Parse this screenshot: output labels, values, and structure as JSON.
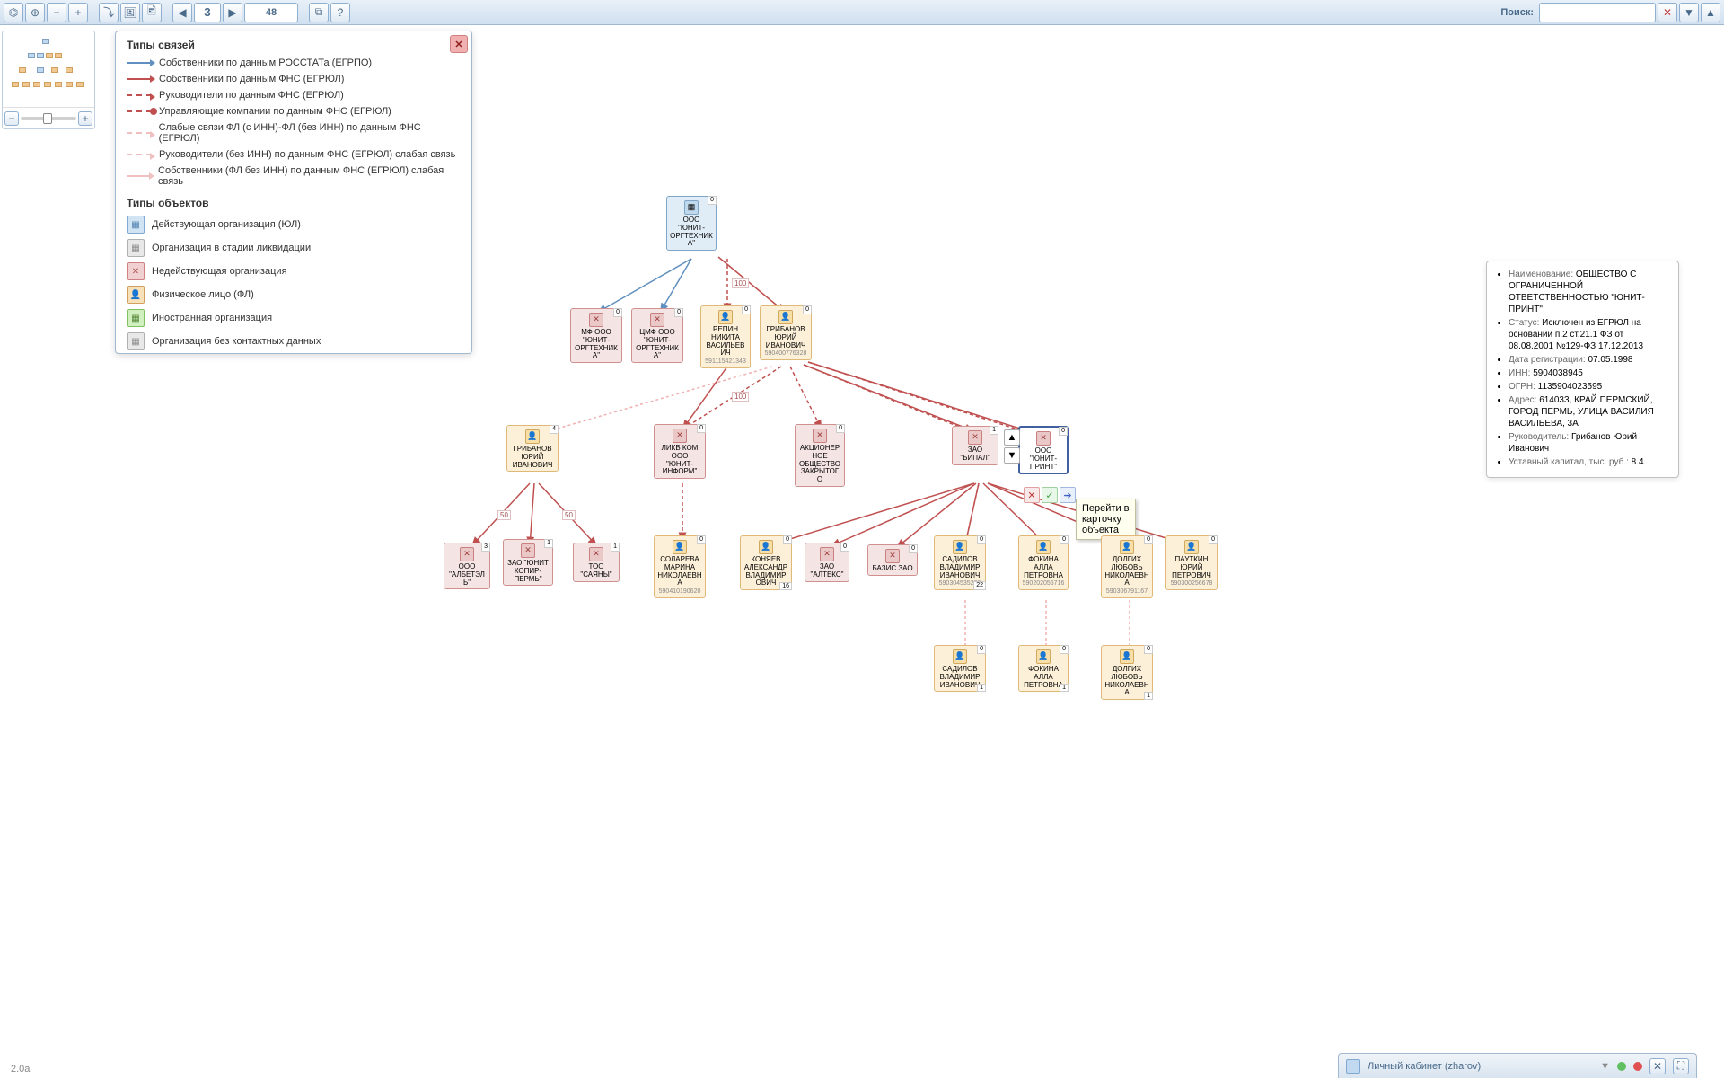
{
  "toolbar": {
    "page_value": "3",
    "counter": "48",
    "search_label": "Поиск:"
  },
  "legend": {
    "title_links": "Типы связей",
    "l1": "Собственники по данным РОССТАТа (ЕГРПО)",
    "l2": "Собственники по данным ФНС (ЕГРЮЛ)",
    "l3": "Руководители по данным ФНС (ЕГРЮЛ)",
    "l4": "Управляющие компании по данным ФНС (ЕГРЮЛ)",
    "l5": "Слабые связи ФЛ (с ИНН)-ФЛ (без ИНН) по данным ФНС (ЕГРЮЛ)",
    "l6": "Руководители (без ИНН) по данным ФНС (ЕГРЮЛ) слабая связь",
    "l7": "Собственники (ФЛ без ИНН) по данным ФНС (ЕГРЮЛ) слабая связь",
    "title_obj": "Типы объектов",
    "o1": "Действующая организация (ЮЛ)",
    "o2": "Организация в стадии ликвидации",
    "o3": "Недействующая организация",
    "o4": "Физическое лицо (ФЛ)",
    "o5": "Иностранная организация",
    "o6": "Организация без контактных данных"
  },
  "nodes": {
    "n_root": "ООО \"ЮНИТ-ОРГТЕХНИКА\"",
    "n_mf": "МФ ООО \"ЮНИТ-ОРГТЕХНИКА\"",
    "n_cmf": "ЦМФ ООО \"ЮНИТ-ОРГТЕХНИКА\"",
    "n_repin": "РЕПИН НИКИТА ВАСИЛЬЕВИЧ",
    "n_repin_id": "591115421343",
    "n_gribanov": "ГРИБАНОВ ЮРИЙ ИВАНОВИЧ",
    "n_gribanov_id": "590400776328",
    "n_gribanov2": "ГРИБАНОВ ЮРИЙ ИВАНОВИЧ",
    "n_likvkom": "ЛИКВ КОМ ООО \"ЮНИТ-ИНФОРМ\"",
    "n_ao_closed": "АКЦИОНЕРНОЕ ОБЩЕСТВО ЗАКРЫТОГО",
    "n_bipal": "ЗАО \"БИПАЛ\"",
    "n_print": "ООО \"ЮНИТ-ПРИНТ\"",
    "n_albetel": "ООО \"АЛБЕТЭЛЬ\"",
    "n_kopir": "ЗАО \"ЮНИТ КОПИР-ПЕРМЬ\"",
    "n_sayany": "ТОО \"САЯНЫ\"",
    "n_solareva": "СОЛАРЕВА МАРИНА НИКОЛАЕВНА",
    "n_solareva_id": "590410190620",
    "n_konyaev": "КОНЯЕВ АЛЕКСАНДР ВЛАДИМИРОВИЧ",
    "n_alteks": "ЗАО \"АЛТЕКС\"",
    "n_bazis": "БАЗИС ЗАО",
    "n_sadilov": "САДИЛОВ ВЛАДИМИР ИВАНОВИЧ",
    "n_sadilov_id": "590304535286",
    "n_fokina": "ФОКИНА АЛЛА ПЕТРОВНА",
    "n_fokina_id": "590202055716",
    "n_dolgih": "ДОЛГИХ ЛЮБОВЬ НИКОЛАЕВНА",
    "n_dolgih_id": "590306791167",
    "n_pautkin": "ПАУТКИН ЮРИЙ ПЕТРОВИЧ",
    "n_pautkin_id": "590300256678",
    "n_sadilov2": "САДИЛОВ ВЛАДИМИР ИВАНОВИЧ",
    "n_fokina2": "ФОКИНА АЛЛА ПЕТРОВНА",
    "n_dolgih2": "ДОЛГИХ ЛЮБОВЬ НИКОЛАЕВНА"
  },
  "badges": {
    "root_tr": "0",
    "mf_tr": "0",
    "cmf_tr": "0",
    "repin_tr": "0",
    "gribanov_tr": "0",
    "gribanov2_tr": "4",
    "likvkom_tr": "0",
    "ao_tr": "0",
    "bipal_tr": "1",
    "print_tr": "0",
    "albetel_tr": "3",
    "kopir_tr": "1",
    "sayany_tr": "1",
    "solareva_tr": "0",
    "konyaev_tr": "0",
    "konyaev_br": "16",
    "alteks_tr": "0",
    "bazis_tr": "0",
    "sadilov_tr": "0",
    "sadilov_br": "22",
    "fokina_tr": "0",
    "dolgih_tr": "0",
    "pautkin_tr": "0",
    "sadilov2_tr": "0",
    "sadilov2_br": "1",
    "fokina2_tr": "0",
    "fokina2_br": "1",
    "dolgih2_tr": "0",
    "dolgih2_br": "1"
  },
  "edge_labels": {
    "e1": "100",
    "e2": "100",
    "e3": "50",
    "e4": "50"
  },
  "tooltip": "Перейти в\nкарточку\nобъекта",
  "info": {
    "name_lbl": "Наименование: ",
    "name_val": "ОБЩЕСТВО С ОГРАНИЧЕННОЙ ОТВЕТСТВЕННОСТЬЮ \"ЮНИТ-ПРИНТ\"",
    "status_lbl": "Статус: ",
    "status_val": "Исключен из ЕГРЮЛ на основании п.2 ст.21.1 ФЗ от 08.08.2001 №129-ФЗ 17.12.2013",
    "reg_lbl": "Дата регистрации: ",
    "reg_val": "07.05.1998",
    "inn_lbl": "ИНН: ",
    "inn_val": "5904038945",
    "ogrn_lbl": "ОГРН: ",
    "ogrn_val": "1135904023595",
    "addr_lbl": "Адрес: ",
    "addr_val": "614033, КРАЙ ПЕРМСКИЙ, ГОРОД ПЕРМЬ, УЛИЦА ВАСИЛИЯ ВАСИЛЬЕВА, 3А",
    "ruk_lbl": "Руководитель: ",
    "ruk_val": "Грибанов Юрий Иванович",
    "cap_lbl": "Уставный капитал, тыс. руб.: ",
    "cap_val": "8.4"
  },
  "footer": {
    "version": "2.0a",
    "user": "Личный кабинет (zharov)"
  }
}
